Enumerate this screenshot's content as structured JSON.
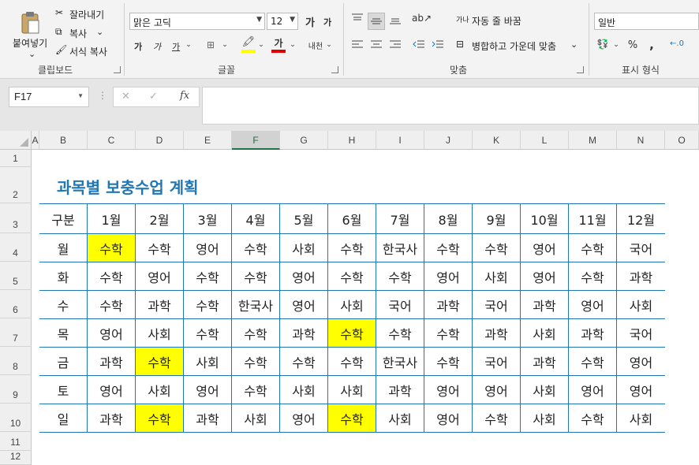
{
  "ribbon": {
    "clipboard": {
      "paste_label": "붙여넣기",
      "cut_label": "잘라내기",
      "copy_label": "복사",
      "format_painter_label": "서식 복사",
      "group_label": "클립보드"
    },
    "font": {
      "font_name": "맑은 고딕",
      "font_size": "12",
      "grow_label": "가",
      "shrink_label": "가",
      "bold_label": "가",
      "italic_label": "가",
      "underline_label": "가",
      "font_color_label": "가",
      "phonetic_label": "내천",
      "group_label": "글꼴",
      "fill_color": "#ffff00",
      "font_color": "#e00000"
    },
    "alignment": {
      "wrap_text_label": "자동 줄 바꿈",
      "merge_center_label": "병합하고 가운데 맞춤",
      "wrap_icon_text": "가나",
      "group_label": "맞춤"
    },
    "number": {
      "format_value": "일반",
      "percent_label": "%",
      "comma_label": ",",
      "group_label": "표시 형식"
    }
  },
  "formula_bar": {
    "name_box": "F17",
    "fx_label": "fx",
    "cancel_label": "✕",
    "enter_label": "✓",
    "formula_value": ""
  },
  "columns": [
    "A",
    "B",
    "C",
    "D",
    "E",
    "F",
    "G",
    "H",
    "I",
    "J",
    "K",
    "L",
    "M",
    "N",
    "O"
  ],
  "active_column": "F",
  "rows": [
    "1",
    "2",
    "3",
    "4",
    "5",
    "6",
    "7",
    "8",
    "9",
    "10",
    "11",
    "12"
  ],
  "sheet": {
    "title": "과목별 보충수업 계획",
    "headers": [
      "구분",
      "1월",
      "2월",
      "3월",
      "4월",
      "5월",
      "6월",
      "7월",
      "8월",
      "9월",
      "10월",
      "11월",
      "12월"
    ],
    "table": [
      [
        "월",
        "수학",
        "수학",
        "영어",
        "수학",
        "사회",
        "수학",
        "한국사",
        "수학",
        "수학",
        "영어",
        "수학",
        "국어"
      ],
      [
        "화",
        "수학",
        "영어",
        "수학",
        "수학",
        "영어",
        "수학",
        "수학",
        "영어",
        "사회",
        "영어",
        "수학",
        "과학"
      ],
      [
        "수",
        "수학",
        "과학",
        "수학",
        "한국사",
        "영어",
        "사회",
        "국어",
        "과학",
        "국어",
        "과학",
        "영어",
        "사회"
      ],
      [
        "목",
        "영어",
        "사회",
        "수학",
        "수학",
        "과학",
        "수학",
        "수학",
        "수학",
        "과학",
        "사회",
        "과학",
        "국어"
      ],
      [
        "금",
        "과학",
        "수학",
        "사회",
        "수학",
        "수학",
        "수학",
        "한국사",
        "수학",
        "국어",
        "과학",
        "수학",
        "영어"
      ],
      [
        "토",
        "영어",
        "사회",
        "영어",
        "수학",
        "사회",
        "사회",
        "과학",
        "영어",
        "영어",
        "사회",
        "영어",
        "영어"
      ],
      [
        "일",
        "과학",
        "수학",
        "과학",
        "사회",
        "영어",
        "수학",
        "사회",
        "영어",
        "수학",
        "사회",
        "수학",
        "사회"
      ]
    ],
    "highlighted_cells": [
      [
        0,
        1
      ],
      [
        3,
        6
      ],
      [
        4,
        2
      ],
      [
        6,
        2
      ],
      [
        6,
        6
      ]
    ],
    "highlight_color": "#ffff00",
    "accent_color": "#1f77b4"
  }
}
